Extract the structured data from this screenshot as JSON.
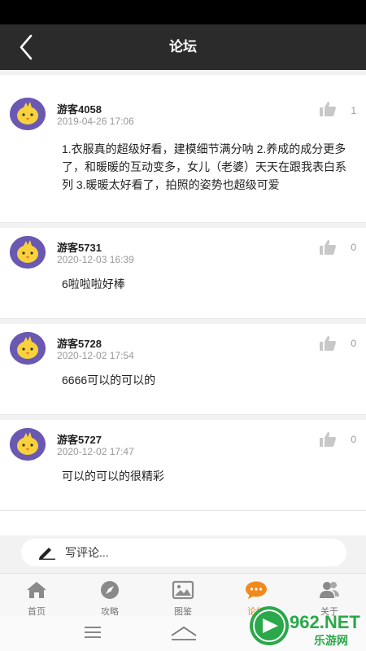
{
  "header": {
    "title": "论坛"
  },
  "posts": [
    {
      "username": "游客4058",
      "time": "2019-04-26 17:06",
      "likes": "1",
      "content": "1.衣服真的超级好看，建模细节满分呐 2.养成的成分更多了，和暖暖的互动变多，女儿（老婆）天天在跟我表白系列 3.暖暖太好看了，拍照的姿势也超级可爱"
    },
    {
      "username": "游客5731",
      "time": "2020-12-03 16:39",
      "likes": "0",
      "content": "6啦啦啦好棒"
    },
    {
      "username": "游客5728",
      "time": "2020-12-02 17:54",
      "likes": "0",
      "content": "6666可以的可以的"
    },
    {
      "username": "游客5727",
      "time": "2020-12-02 17:47",
      "likes": "0",
      "content": "可以的可以的很精彩"
    }
  ],
  "comment": {
    "placeholder": "写评论..."
  },
  "tabs": [
    {
      "label": "首页",
      "icon": "home-icon"
    },
    {
      "label": "攻略",
      "icon": "compass-icon"
    },
    {
      "label": "图鉴",
      "icon": "image-icon"
    },
    {
      "label": "论坛",
      "icon": "chat-icon",
      "active": true
    },
    {
      "label": "关于",
      "icon": "user-icon"
    }
  ],
  "watermark": {
    "text": "962.NET",
    "subtext": "乐游网"
  },
  "colors": {
    "nav": "#2b2b2b",
    "active_tab": "#f08a1c",
    "avatar": "#6a58b3"
  }
}
